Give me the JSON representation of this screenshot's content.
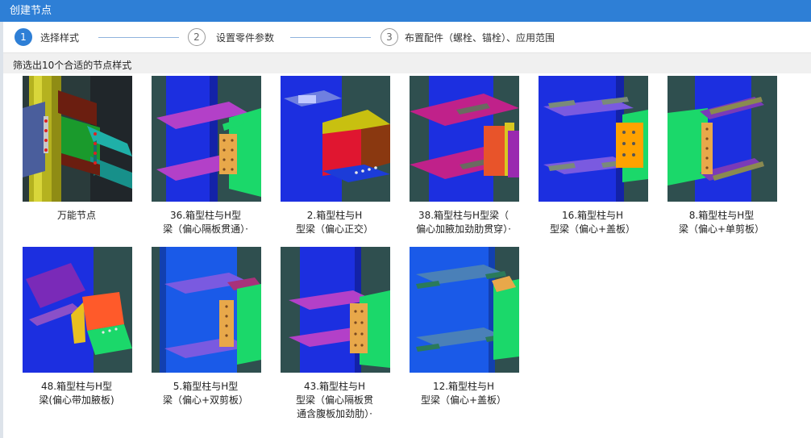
{
  "window": {
    "title": "创建节点"
  },
  "steps": [
    {
      "num": "1",
      "label": "选择样式",
      "active": true
    },
    {
      "num": "2",
      "label": "设置零件参数",
      "active": false
    },
    {
      "num": "3",
      "label": "布置配件（螺栓、锚栓）、应用范围",
      "active": false
    }
  ],
  "filter": {
    "label": "筛选出10个合适的节点样式"
  },
  "nodes": [
    {
      "caption": "万能节点",
      "icon": "universal-node-icon"
    },
    {
      "caption": "36.箱型柱与H型\n梁（偏心隔板贯通）·",
      "icon": "box-column-h-beam-icon"
    },
    {
      "caption": "2.箱型柱与H\n型梁（偏心正交）",
      "icon": "box-column-h-beam-icon"
    },
    {
      "caption": "38.箱型柱与H型梁（\n偏心加腋加劲肋贯穿）·",
      "icon": "box-column-h-beam-icon"
    },
    {
      "caption": "16.箱型柱与H\n型梁（偏心+盖板）",
      "icon": "box-column-h-beam-icon"
    },
    {
      "caption": "8.箱型柱与H型\n梁（偏心+单剪板）",
      "icon": "box-column-h-beam-icon"
    },
    {
      "caption": "48.箱型柱与H型\n梁(偏心带加腋板)",
      "icon": "box-column-h-beam-icon"
    },
    {
      "caption": "5.箱型柱与H型\n梁（偏心+双剪板）",
      "icon": "box-column-h-beam-icon"
    },
    {
      "caption": "43.箱型柱与H\n型梁（偏心隔板贯\n通含腹板加劲肋）·",
      "icon": "box-column-h-beam-icon"
    },
    {
      "caption": "12.箱型柱与H\n型梁（偏心+盖板）",
      "icon": "box-column-h-beam-icon"
    }
  ],
  "colors": {
    "titlebar": "#2e7fd6",
    "column": "#1c2fe0",
    "background": "#2f4f4f"
  }
}
